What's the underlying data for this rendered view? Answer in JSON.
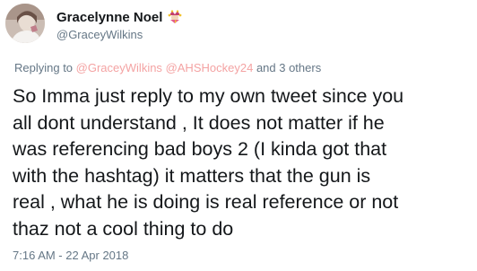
{
  "author": {
    "display_name": "Gracelynne Noel",
    "handle": "@GraceyWilkins",
    "badge_icon": "jester-emoji-icon",
    "avatar_icon": "profile-photo-avatar"
  },
  "reply_context": {
    "prefix": "Replying to",
    "mentions": [
      "@GraceyWilkins",
      "@AHSHockey24"
    ],
    "suffix": "and 3 others"
  },
  "tweet": {
    "lines": [
      "So Imma just reply to my own tweet since you",
      "all dont understand , It does not matter if he",
      "was referencing bad boys 2 (I kinda got that",
      "with the hashtag) it matters that the gun is",
      "real , what he is doing is real reference or not",
      "thaz not a cool thing to do"
    ]
  },
  "timestamp": "7:16 AM - 22 Apr 2018",
  "colors": {
    "text": "#14171a",
    "secondary": "#657786",
    "mention": "#f4a3a3"
  }
}
